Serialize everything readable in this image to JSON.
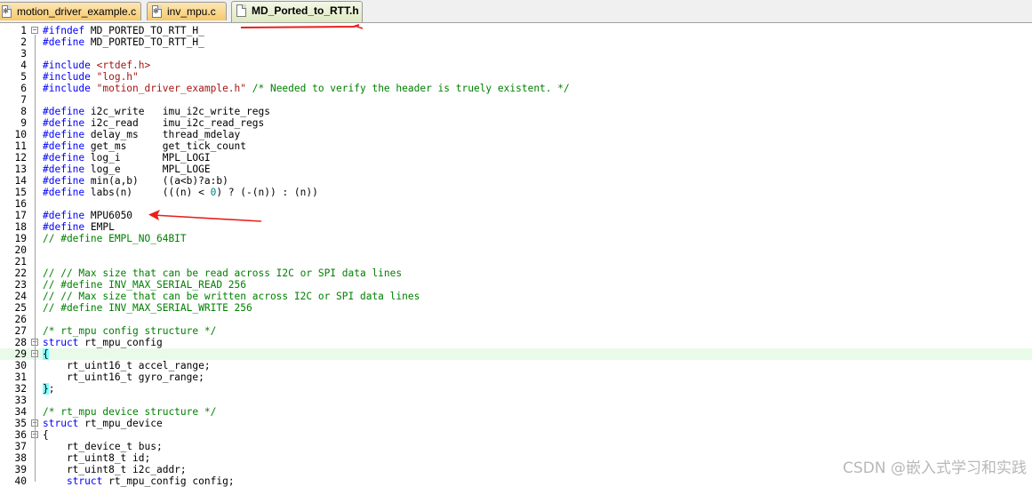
{
  "tabs": [
    {
      "label": "motion_driver_example.c",
      "icon": "c-file-icon",
      "active": false
    },
    {
      "label": "inv_mpu.c",
      "icon": "c-file-icon",
      "active": false
    },
    {
      "label": "MD_Ported_to_RTT.h",
      "icon": "h-file-icon",
      "active": true
    }
  ],
  "lines": [
    {
      "n": "1",
      "parts": [
        [
          "kw",
          "#ifndef"
        ],
        [
          "",
          "MD_PORTED_TO_RTT_H_"
        ]
      ]
    },
    {
      "n": "2",
      "parts": [
        [
          "kw",
          "#define"
        ],
        [
          "",
          "MD_PORTED_TO_RTT_H_"
        ]
      ]
    },
    {
      "n": "3",
      "parts": []
    },
    {
      "n": "4",
      "parts": [
        [
          "kw",
          "#include"
        ],
        [
          "str",
          "<rtdef.h>"
        ]
      ]
    },
    {
      "n": "5",
      "parts": [
        [
          "kw",
          "#include"
        ],
        [
          "str",
          "\"log.h\""
        ]
      ]
    },
    {
      "n": "6",
      "parts": [
        [
          "kw",
          "#include"
        ],
        [
          "str",
          "\"motion_driver_example.h\""
        ],
        [
          "cm",
          "/* Needed to verify the header is truely existent. */"
        ]
      ]
    },
    {
      "n": "7",
      "parts": []
    },
    {
      "n": "8",
      "parts": [
        [
          "kw",
          "#define"
        ],
        [
          "",
          "i2c_write   imu_i2c_write_regs"
        ]
      ]
    },
    {
      "n": "9",
      "parts": [
        [
          "kw",
          "#define"
        ],
        [
          "",
          "i2c_read    imu_i2c_read_regs"
        ]
      ]
    },
    {
      "n": "10",
      "parts": [
        [
          "kw",
          "#define"
        ],
        [
          "",
          "delay_ms    thread_mdelay"
        ]
      ]
    },
    {
      "n": "11",
      "parts": [
        [
          "kw",
          "#define"
        ],
        [
          "",
          "get_ms      get_tick_count"
        ]
      ]
    },
    {
      "n": "12",
      "parts": [
        [
          "kw",
          "#define"
        ],
        [
          "",
          "log_i       MPL_LOGI"
        ]
      ]
    },
    {
      "n": "13",
      "parts": [
        [
          "kw",
          "#define"
        ],
        [
          "",
          "log_e       MPL_LOGE"
        ]
      ]
    },
    {
      "n": "14",
      "parts": [
        [
          "kw",
          "#define"
        ],
        [
          "",
          "min(a,b)    ((a<b)?a:b)"
        ]
      ]
    },
    {
      "n": "15",
      "parts": [
        [
          "kw",
          "#define"
        ],
        [
          "",
          "labs(n)     (((n) < "
        ],
        [
          "num",
          "0"
        ],
        [
          "",
          ") ? (-(n)) : (n))"
        ]
      ]
    },
    {
      "n": "16",
      "parts": []
    },
    {
      "n": "17",
      "parts": [
        [
          "kw",
          "#define"
        ],
        [
          "",
          "MPU6050"
        ]
      ]
    },
    {
      "n": "18",
      "parts": [
        [
          "kw",
          "#define"
        ],
        [
          "",
          "EMPL"
        ]
      ]
    },
    {
      "n": "19",
      "parts": [
        [
          "cm",
          "// #define EMPL_NO_64BIT"
        ]
      ]
    },
    {
      "n": "20",
      "parts": []
    },
    {
      "n": "21",
      "parts": []
    },
    {
      "n": "22",
      "parts": [
        [
          "cm",
          "// // Max size that can be read across I2C or SPI data lines"
        ]
      ]
    },
    {
      "n": "23",
      "parts": [
        [
          "cm",
          "// #define INV_MAX_SERIAL_READ 256"
        ]
      ]
    },
    {
      "n": "24",
      "parts": [
        [
          "cm",
          "// // Max size that can be written across I2C or SPI data lines"
        ]
      ]
    },
    {
      "n": "25",
      "parts": [
        [
          "cm",
          "// #define INV_MAX_SERIAL_WRITE 256"
        ]
      ]
    },
    {
      "n": "26",
      "parts": []
    },
    {
      "n": "27",
      "parts": [
        [
          "cm",
          "/* rt_mpu config structure */"
        ]
      ]
    },
    {
      "n": "28",
      "parts": [
        [
          "kw",
          "struct"
        ],
        [
          "",
          "rt_mpu_config"
        ]
      ]
    },
    {
      "n": "29",
      "parts": [
        [
          "brace",
          "{"
        ]
      ]
    },
    {
      "n": "30",
      "parts": [
        [
          "",
          "    rt_uint16_t accel_range;"
        ]
      ]
    },
    {
      "n": "31",
      "parts": [
        [
          "",
          "    rt_uint16_t gyro_range;"
        ]
      ]
    },
    {
      "n": "32",
      "parts": [
        [
          "brace",
          "}"
        ],
        [
          "",
          ";"
        ]
      ]
    },
    {
      "n": "33",
      "parts": []
    },
    {
      "n": "34",
      "parts": [
        [
          "cm",
          "/* rt_mpu device structure */"
        ]
      ]
    },
    {
      "n": "35",
      "parts": [
        [
          "kw",
          "struct"
        ],
        [
          "",
          "rt_mpu_device"
        ]
      ]
    },
    {
      "n": "36",
      "parts": [
        [
          "",
          "{"
        ]
      ]
    },
    {
      "n": "37",
      "parts": [
        [
          "",
          "    rt_device_t bus;"
        ]
      ]
    },
    {
      "n": "38",
      "parts": [
        [
          "",
          "    rt_uint8_t id;"
        ]
      ]
    },
    {
      "n": "39",
      "parts": [
        [
          "",
          "    rt_uint8_t i2c_addr;"
        ]
      ]
    },
    {
      "n": "40",
      "parts": [
        [
          "",
          "    "
        ],
        [
          "kw",
          "struct"
        ],
        [
          "",
          "rt_mpu_config config;"
        ]
      ]
    }
  ],
  "current_line": "29",
  "watermark": "CSDN @嵌入式学习和实践",
  "annotation_color": "#e8201a"
}
